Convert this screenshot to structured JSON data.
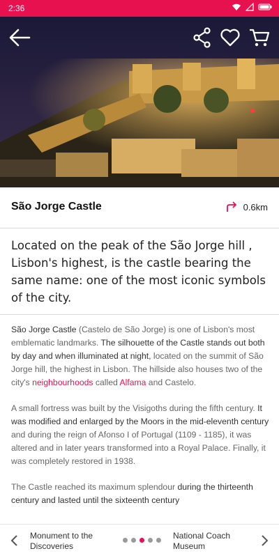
{
  "status": {
    "time": "2:36"
  },
  "title": "São Jorge Castle",
  "distance": "0.6km",
  "lead": "Located on the peak of the São Jorge hill , Lisbon's highest, is the castle bearing the same name: one of the most iconic symbols of the city.",
  "paragraphs": [
    [
      {
        "t": "São Jorge Castle",
        "s": "b"
      },
      {
        "t": " (Castelo de São Jorge) is one of Lisbon's most emblematic landmarks. ",
        "s": "n"
      },
      {
        "t": "The silhouette of the Castle stands out both by day and when illuminated at night,",
        "s": "b"
      },
      {
        "t": " located on the summit of São Jorge hill, the highest in Lisbon. The hillside also houses two of the city's ",
        "s": "n"
      },
      {
        "t": "neighbourhoods",
        "s": "a"
      },
      {
        "t": " called ",
        "s": "n"
      },
      {
        "t": "Alfama",
        "s": "a"
      },
      {
        "t": " and Castelo.",
        "s": "n"
      }
    ],
    [
      {
        "t": "A small fortress was built by the Visigoths during the fifth century. ",
        "s": "n"
      },
      {
        "t": "It was modified and enlarged by the Moors in the mid-eleventh century",
        "s": "b"
      },
      {
        "t": " and during the reign of Afonso I of Portugal (1109 - 1185), it was altered and in later years transformed into a Royal Palace. Finally, it was completely restored in 1938.",
        "s": "n"
      }
    ],
    [
      {
        "t": "The Castle reached its maximum splendour ",
        "s": "n"
      },
      {
        "t": "during the thirteenth century and lasted until the sixteenth century",
        "s": "b"
      }
    ]
  ],
  "nav": {
    "prev": "Monument to the Discoveries",
    "next": "National Coach Museum",
    "dots": 5,
    "active": 2
  },
  "colors": {
    "accent": "#e8114f"
  }
}
